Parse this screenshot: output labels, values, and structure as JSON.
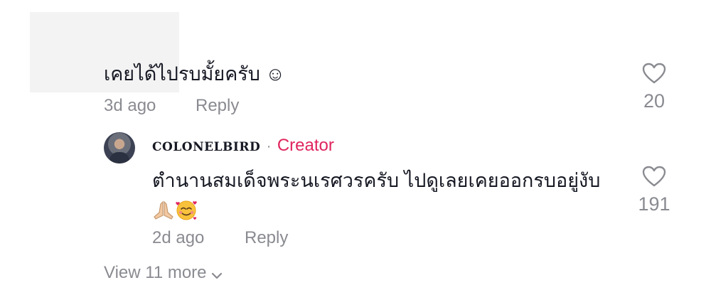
{
  "comment": {
    "text": "เคยได้ไปรบมั้ยครับ ☺",
    "time": "3d ago",
    "reply_label": "Reply",
    "likes": "20"
  },
  "reply": {
    "username": "COLONELBIRD",
    "separator": "·",
    "badge": "Creator",
    "text": "ตำนานสมเด็จพระนเรศวรครับ ไปดูเลยเคยออกรบอยู่งับ",
    "time": "2d ago",
    "reply_label": "Reply",
    "likes": "191"
  },
  "view_more": {
    "label": "View 11 more"
  },
  "colors": {
    "text": "#161823",
    "muted": "#8a8b91",
    "creator_badge": "#e0245e"
  },
  "icons": {
    "like": "heart-outline-icon",
    "expand": "chevron-down-icon",
    "emoji_1": "folded-hands-emoji",
    "emoji_2": "smiling-face-with-hearts-emoji"
  }
}
